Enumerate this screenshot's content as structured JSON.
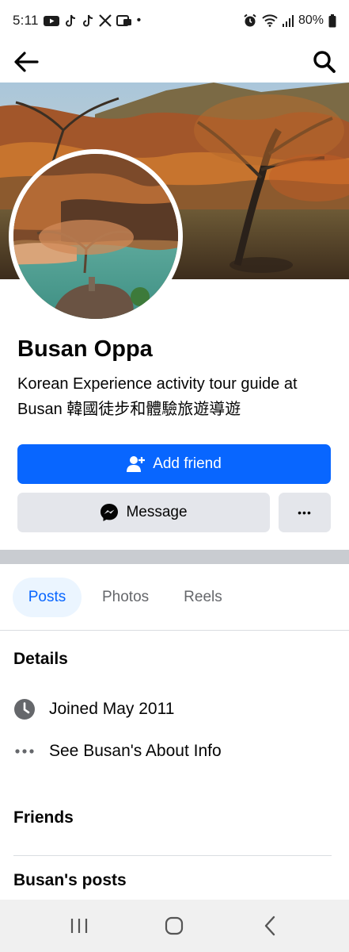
{
  "status_bar": {
    "time": "5:11",
    "battery_percent": "80%",
    "dot": "•"
  },
  "app_bar": {
    "back_icon": "arrow-left-icon",
    "search_icon": "search-icon"
  },
  "profile": {
    "name": "Busan Oppa",
    "bio": "Korean Experience activity tour guide at Busan 韓國徒步和體驗旅遊導遊"
  },
  "actions": {
    "add_friend_label": "Add friend",
    "message_label": "Message",
    "more_label": "•••"
  },
  "tabs": [
    {
      "label": "Posts",
      "active": true
    },
    {
      "label": "Photos",
      "active": false
    },
    {
      "label": "Reels",
      "active": false
    }
  ],
  "details": {
    "title": "Details",
    "items": [
      {
        "icon": "clock-icon",
        "text": "Joined May 2011"
      },
      {
        "icon": "more-dots-icon",
        "text": "See Busan's About Info"
      }
    ]
  },
  "friends": {
    "title": "Friends"
  },
  "posts": {
    "title": "Busan's posts"
  },
  "colors": {
    "accent": "#0866ff",
    "tab_active_bg": "#ebf5ff",
    "button_secondary": "#e4e6eb",
    "divider": "#c9ccd1"
  }
}
